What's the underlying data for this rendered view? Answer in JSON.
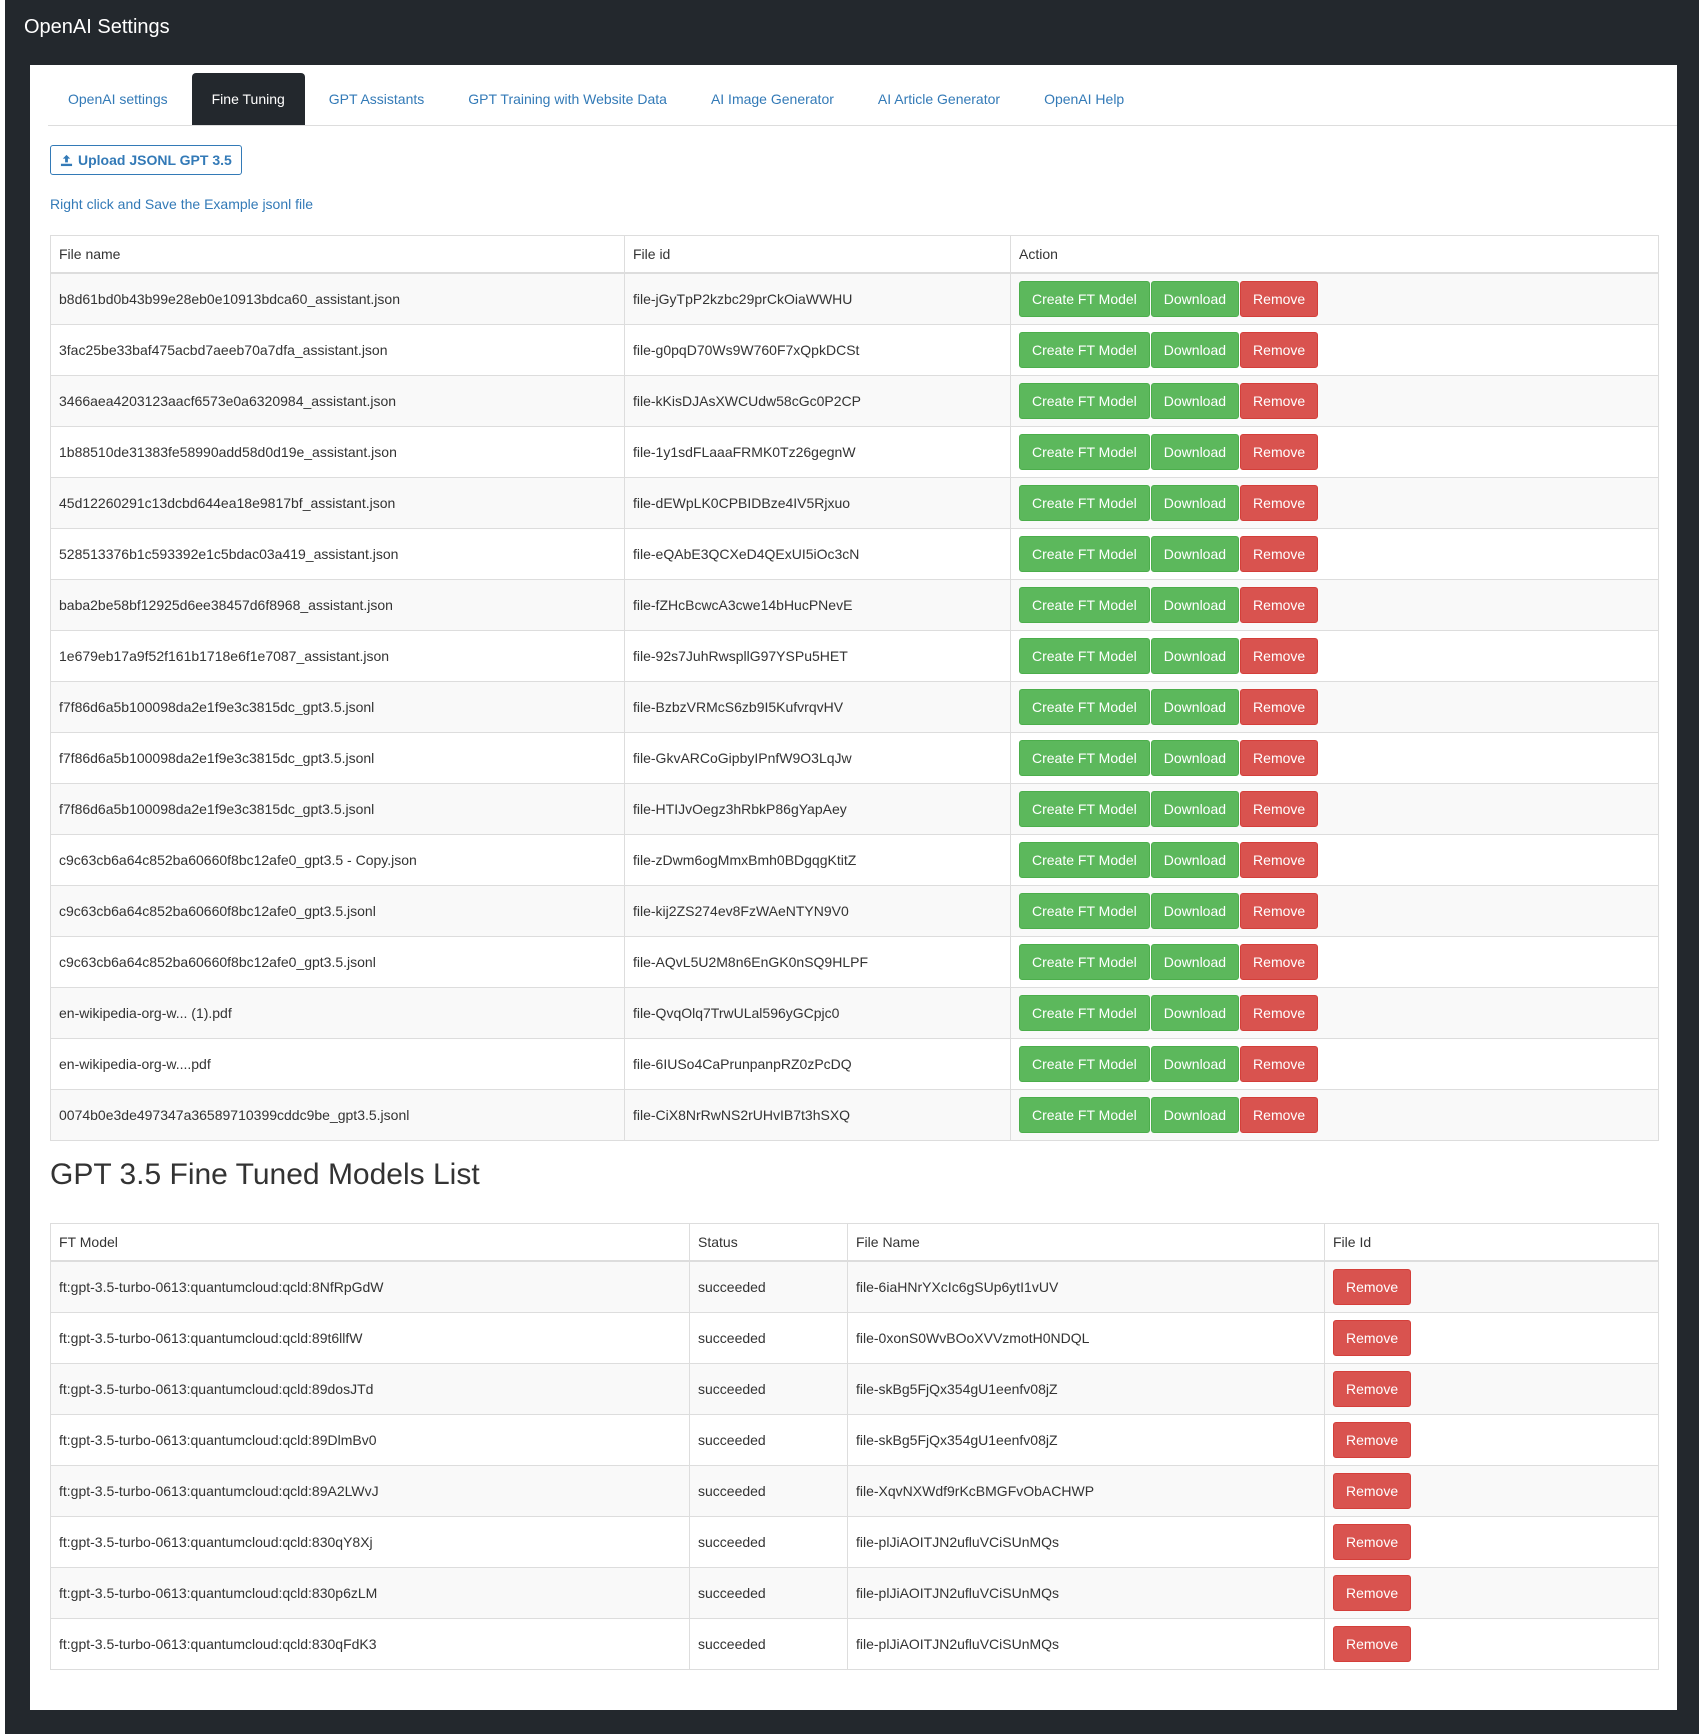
{
  "app": {
    "title": "OpenAI Settings"
  },
  "tabs": [
    {
      "label": "OpenAI settings",
      "active": false
    },
    {
      "label": "Fine Tuning",
      "active": true
    },
    {
      "label": "GPT Assistants",
      "active": false
    },
    {
      "label": "GPT Training with Website Data",
      "active": false
    },
    {
      "label": "AI Image Generator",
      "active": false
    },
    {
      "label": "AI Article Generator",
      "active": false
    },
    {
      "label": "OpenAI Help",
      "active": false
    }
  ],
  "upload": {
    "label": "Upload JSONL GPT 3.5",
    "icon": "upload-icon"
  },
  "example_link": "Right click and Save the Example jsonl file",
  "files_table": {
    "headers": [
      "File name",
      "File id",
      "Action"
    ],
    "actions": {
      "create": "Create FT Model",
      "download": "Download",
      "remove": "Remove"
    },
    "rows": [
      {
        "name": "b8d61bd0b43b99e28eb0e10913bdca60_assistant.json",
        "id": "file-jGyTpP2kzbc29prCkOiaWWHU"
      },
      {
        "name": "3fac25be33baf475acbd7aeeb70a7dfa_assistant.json",
        "id": "file-g0pqD70Ws9W760F7xQpkDCSt"
      },
      {
        "name": "3466aea4203123aacf6573e0a6320984_assistant.json",
        "id": "file-kKisDJAsXWCUdw58cGc0P2CP"
      },
      {
        "name": "1b88510de31383fe58990add58d0d19e_assistant.json",
        "id": "file-1y1sdFLaaaFRMK0Tz26gegnW"
      },
      {
        "name": "45d12260291c13dcbd644ea18e9817bf_assistant.json",
        "id": "file-dEWpLK0CPBIDBze4IV5Rjxuo"
      },
      {
        "name": "528513376b1c593392e1c5bdac03a419_assistant.json",
        "id": "file-eQAbE3QCXeD4QExUI5iOc3cN"
      },
      {
        "name": "baba2be58bf12925d6ee38457d6f8968_assistant.json",
        "id": "file-fZHcBcwcA3cwe14bHucPNevE"
      },
      {
        "name": "1e679eb17a9f52f161b1718e6f1e7087_assistant.json",
        "id": "file-92s7JuhRwspllG97YSPu5HET"
      },
      {
        "name": "f7f86d6a5b100098da2e1f9e3c3815dc_gpt3.5.jsonl",
        "id": "file-BzbzVRMcS6zb9I5KufvrqvHV"
      },
      {
        "name": "f7f86d6a5b100098da2e1f9e3c3815dc_gpt3.5.jsonl",
        "id": "file-GkvARCoGipbyIPnfW9O3LqJw"
      },
      {
        "name": "f7f86d6a5b100098da2e1f9e3c3815dc_gpt3.5.jsonl",
        "id": "file-HTIJvOegz3hRbkP86gYapAey"
      },
      {
        "name": "c9c63cb6a64c852ba60660f8bc12afe0_gpt3.5 - Copy.json",
        "id": "file-zDwm6ogMmxBmh0BDgqgKtitZ"
      },
      {
        "name": "c9c63cb6a64c852ba60660f8bc12afe0_gpt3.5.jsonl",
        "id": "file-kij2ZS274ev8FzWAeNTYN9V0"
      },
      {
        "name": "c9c63cb6a64c852ba60660f8bc12afe0_gpt3.5.jsonl",
        "id": "file-AQvL5U2M8n6EnGK0nSQ9HLPF"
      },
      {
        "name": "en-wikipedia-org-w... (1).pdf",
        "id": "file-QvqOlq7TrwULal596yGCpjc0"
      },
      {
        "name": "en-wikipedia-org-w....pdf",
        "id": "file-6IUSo4CaPrunpanpRZ0zPcDQ"
      },
      {
        "name": "0074b0e3de497347a36589710399cddc9be_gpt3.5.jsonl",
        "id": "file-CiX8NrRwNS2rUHvIB7t3hSXQ"
      }
    ]
  },
  "models_section": {
    "title": "GPT 3.5 Fine Tuned Models List",
    "headers": [
      "FT Model",
      "Status",
      "File Name",
      "File Id"
    ],
    "remove_label": "Remove",
    "rows": [
      {
        "model": "ft:gpt-3.5-turbo-0613:quantumcloud:qcld:8NfRpGdW",
        "status": "succeeded",
        "file": "file-6iaHNrYXcIc6gSUp6ytI1vUV"
      },
      {
        "model": "ft:gpt-3.5-turbo-0613:quantumcloud:qcld:89t6llfW",
        "status": "succeeded",
        "file": "file-0xonS0WvBOoXVVzmotH0NDQL"
      },
      {
        "model": "ft:gpt-3.5-turbo-0613:quantumcloud:qcld:89dosJTd",
        "status": "succeeded",
        "file": "file-skBg5FjQx354gU1eenfv08jZ"
      },
      {
        "model": "ft:gpt-3.5-turbo-0613:quantumcloud:qcld:89DlmBv0",
        "status": "succeeded",
        "file": "file-skBg5FjQx354gU1eenfv08jZ"
      },
      {
        "model": "ft:gpt-3.5-turbo-0613:quantumcloud:qcld:89A2LWvJ",
        "status": "succeeded",
        "file": "file-XqvNXWdf9rKcBMGFvObACHWP"
      },
      {
        "model": "ft:gpt-3.5-turbo-0613:quantumcloud:qcld:830qY8Xj",
        "status": "succeeded",
        "file": "file-plJiAOITJN2ufluVCiSUnMQs"
      },
      {
        "model": "ft:gpt-3.5-turbo-0613:quantumcloud:qcld:830p6zLM",
        "status": "succeeded",
        "file": "file-plJiAOITJN2ufluVCiSUnMQs"
      },
      {
        "model": "ft:gpt-3.5-turbo-0613:quantumcloud:qcld:830qFdK3",
        "status": "succeeded",
        "file": "file-plJiAOITJN2ufluVCiSUnMQs"
      }
    ]
  },
  "colors": {
    "header_bg": "#23282d",
    "link": "#337ab7",
    "success": "#5cb85c",
    "danger": "#d9534f"
  }
}
